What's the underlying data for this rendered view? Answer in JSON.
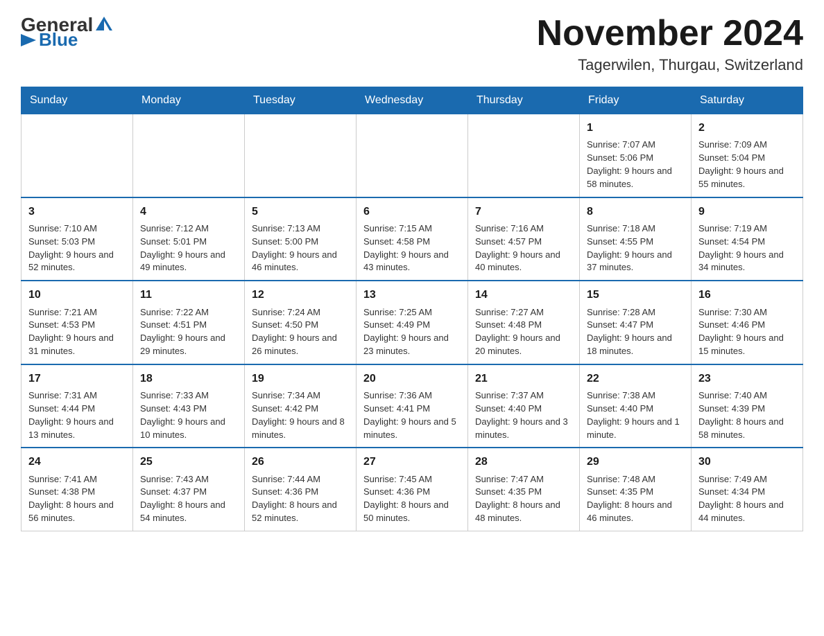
{
  "header": {
    "logo_general": "General",
    "logo_blue": "Blue",
    "title": "November 2024",
    "subtitle": "Tagerwilen, Thurgau, Switzerland"
  },
  "weekdays": [
    "Sunday",
    "Monday",
    "Tuesday",
    "Wednesday",
    "Thursday",
    "Friday",
    "Saturday"
  ],
  "weeks": [
    [
      {
        "day": "",
        "info": ""
      },
      {
        "day": "",
        "info": ""
      },
      {
        "day": "",
        "info": ""
      },
      {
        "day": "",
        "info": ""
      },
      {
        "day": "",
        "info": ""
      },
      {
        "day": "1",
        "info": "Sunrise: 7:07 AM\nSunset: 5:06 PM\nDaylight: 9 hours and 58 minutes."
      },
      {
        "day": "2",
        "info": "Sunrise: 7:09 AM\nSunset: 5:04 PM\nDaylight: 9 hours and 55 minutes."
      }
    ],
    [
      {
        "day": "3",
        "info": "Sunrise: 7:10 AM\nSunset: 5:03 PM\nDaylight: 9 hours and 52 minutes."
      },
      {
        "day": "4",
        "info": "Sunrise: 7:12 AM\nSunset: 5:01 PM\nDaylight: 9 hours and 49 minutes."
      },
      {
        "day": "5",
        "info": "Sunrise: 7:13 AM\nSunset: 5:00 PM\nDaylight: 9 hours and 46 minutes."
      },
      {
        "day": "6",
        "info": "Sunrise: 7:15 AM\nSunset: 4:58 PM\nDaylight: 9 hours and 43 minutes."
      },
      {
        "day": "7",
        "info": "Sunrise: 7:16 AM\nSunset: 4:57 PM\nDaylight: 9 hours and 40 minutes."
      },
      {
        "day": "8",
        "info": "Sunrise: 7:18 AM\nSunset: 4:55 PM\nDaylight: 9 hours and 37 minutes."
      },
      {
        "day": "9",
        "info": "Sunrise: 7:19 AM\nSunset: 4:54 PM\nDaylight: 9 hours and 34 minutes."
      }
    ],
    [
      {
        "day": "10",
        "info": "Sunrise: 7:21 AM\nSunset: 4:53 PM\nDaylight: 9 hours and 31 minutes."
      },
      {
        "day": "11",
        "info": "Sunrise: 7:22 AM\nSunset: 4:51 PM\nDaylight: 9 hours and 29 minutes."
      },
      {
        "day": "12",
        "info": "Sunrise: 7:24 AM\nSunset: 4:50 PM\nDaylight: 9 hours and 26 minutes."
      },
      {
        "day": "13",
        "info": "Sunrise: 7:25 AM\nSunset: 4:49 PM\nDaylight: 9 hours and 23 minutes."
      },
      {
        "day": "14",
        "info": "Sunrise: 7:27 AM\nSunset: 4:48 PM\nDaylight: 9 hours and 20 minutes."
      },
      {
        "day": "15",
        "info": "Sunrise: 7:28 AM\nSunset: 4:47 PM\nDaylight: 9 hours and 18 minutes."
      },
      {
        "day": "16",
        "info": "Sunrise: 7:30 AM\nSunset: 4:46 PM\nDaylight: 9 hours and 15 minutes."
      }
    ],
    [
      {
        "day": "17",
        "info": "Sunrise: 7:31 AM\nSunset: 4:44 PM\nDaylight: 9 hours and 13 minutes."
      },
      {
        "day": "18",
        "info": "Sunrise: 7:33 AM\nSunset: 4:43 PM\nDaylight: 9 hours and 10 minutes."
      },
      {
        "day": "19",
        "info": "Sunrise: 7:34 AM\nSunset: 4:42 PM\nDaylight: 9 hours and 8 minutes."
      },
      {
        "day": "20",
        "info": "Sunrise: 7:36 AM\nSunset: 4:41 PM\nDaylight: 9 hours and 5 minutes."
      },
      {
        "day": "21",
        "info": "Sunrise: 7:37 AM\nSunset: 4:40 PM\nDaylight: 9 hours and 3 minutes."
      },
      {
        "day": "22",
        "info": "Sunrise: 7:38 AM\nSunset: 4:40 PM\nDaylight: 9 hours and 1 minute."
      },
      {
        "day": "23",
        "info": "Sunrise: 7:40 AM\nSunset: 4:39 PM\nDaylight: 8 hours and 58 minutes."
      }
    ],
    [
      {
        "day": "24",
        "info": "Sunrise: 7:41 AM\nSunset: 4:38 PM\nDaylight: 8 hours and 56 minutes."
      },
      {
        "day": "25",
        "info": "Sunrise: 7:43 AM\nSunset: 4:37 PM\nDaylight: 8 hours and 54 minutes."
      },
      {
        "day": "26",
        "info": "Sunrise: 7:44 AM\nSunset: 4:36 PM\nDaylight: 8 hours and 52 minutes."
      },
      {
        "day": "27",
        "info": "Sunrise: 7:45 AM\nSunset: 4:36 PM\nDaylight: 8 hours and 50 minutes."
      },
      {
        "day": "28",
        "info": "Sunrise: 7:47 AM\nSunset: 4:35 PM\nDaylight: 8 hours and 48 minutes."
      },
      {
        "day": "29",
        "info": "Sunrise: 7:48 AM\nSunset: 4:35 PM\nDaylight: 8 hours and 46 minutes."
      },
      {
        "day": "30",
        "info": "Sunrise: 7:49 AM\nSunset: 4:34 PM\nDaylight: 8 hours and 44 minutes."
      }
    ]
  ]
}
